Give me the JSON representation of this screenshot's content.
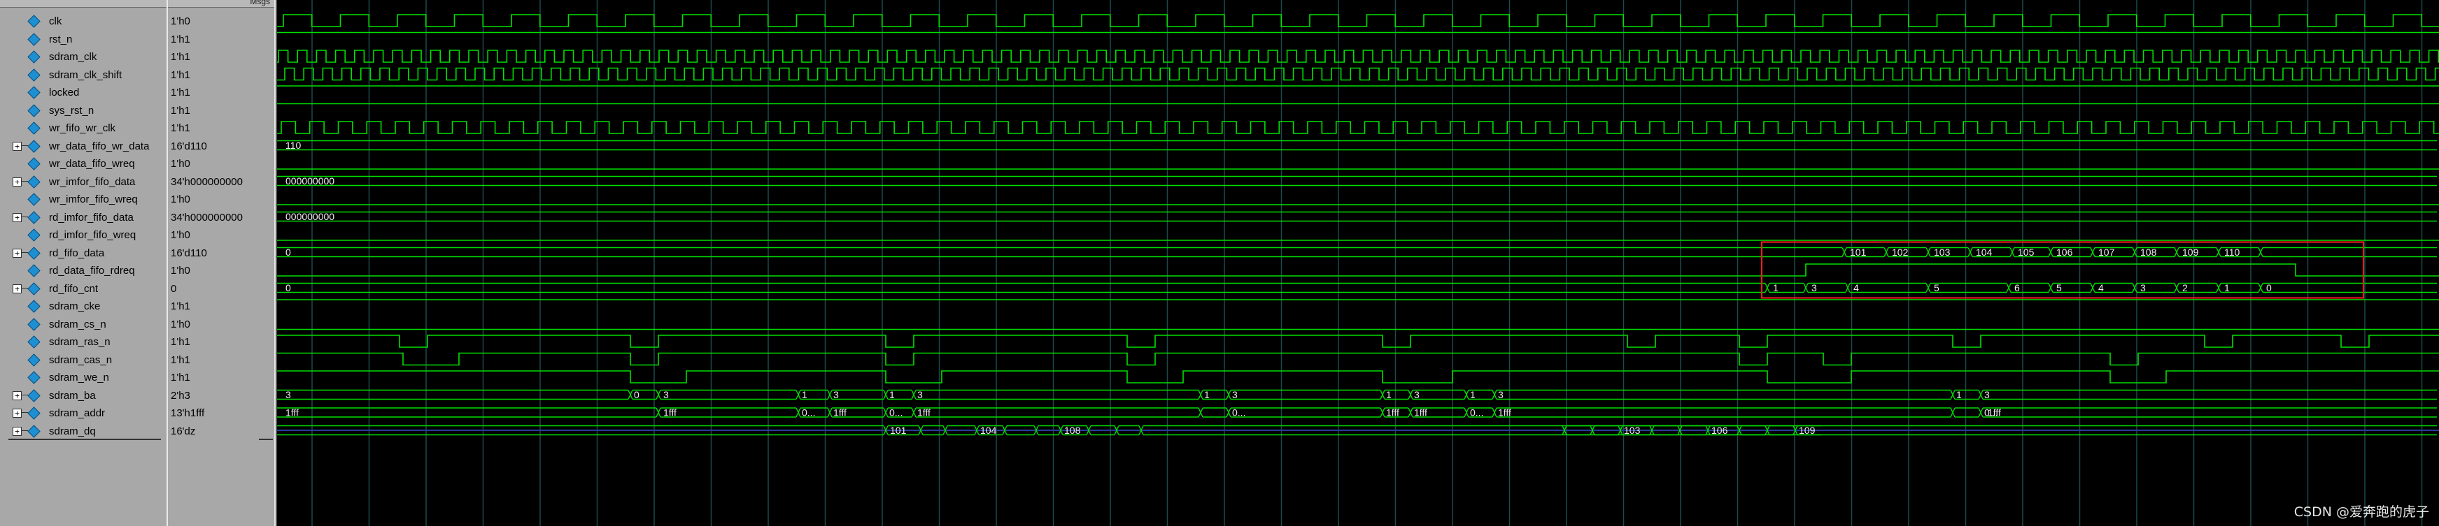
{
  "header": {
    "wave_label": "Msgs"
  },
  "signals": [
    {
      "name": "clk",
      "value": "1'h0",
      "expandable": false
    },
    {
      "name": "rst_n",
      "value": "1'h1",
      "expandable": false
    },
    {
      "name": "sdram_clk",
      "value": "1'h1",
      "expandable": false
    },
    {
      "name": "sdram_clk_shift",
      "value": "1'h1",
      "expandable": false
    },
    {
      "name": "locked",
      "value": "1'h1",
      "expandable": false
    },
    {
      "name": "sys_rst_n",
      "value": "1'h1",
      "expandable": false
    },
    {
      "name": "wr_fifo_wr_clk",
      "value": "1'h1",
      "expandable": false
    },
    {
      "name": "wr_data_fifo_wr_data",
      "value": "16'd110",
      "expandable": true
    },
    {
      "name": "wr_data_fifo_wreq",
      "value": "1'h0",
      "expandable": false
    },
    {
      "name": "wr_imfor_fifo_data",
      "value": "34'h000000000",
      "expandable": true
    },
    {
      "name": "wr_imfor_fifo_wreq",
      "value": "1'h0",
      "expandable": false
    },
    {
      "name": "rd_imfor_fifo_data",
      "value": "34'h000000000",
      "expandable": true
    },
    {
      "name": "rd_imfor_fifo_wreq",
      "value": "1'h0",
      "expandable": false
    },
    {
      "name": "rd_fifo_data",
      "value": "16'd110",
      "expandable": true
    },
    {
      "name": "rd_data_fifo_rdreq",
      "value": "1'h0",
      "expandable": false
    },
    {
      "name": "rd_fifo_cnt",
      "value": "0",
      "expandable": true
    },
    {
      "name": "sdram_cke",
      "value": "1'h1",
      "expandable": false
    },
    {
      "name": "sdram_cs_n",
      "value": "1'h0",
      "expandable": false
    },
    {
      "name": "sdram_ras_n",
      "value": "1'h1",
      "expandable": false
    },
    {
      "name": "sdram_cas_n",
      "value": "1'h1",
      "expandable": false
    },
    {
      "name": "sdram_we_n",
      "value": "1'h1",
      "expandable": false
    },
    {
      "name": "sdram_ba",
      "value": "2'h3",
      "expandable": true
    },
    {
      "name": "sdram_addr",
      "value": "13'h1fff",
      "expandable": true
    },
    {
      "name": "sdram_dq",
      "value": "16'dz",
      "expandable": true
    }
  ],
  "bus_labels": {
    "wr_data_fifo_wr_data": [
      "110"
    ],
    "wr_imfor_fifo_data": [
      "000000000"
    ],
    "rd_imfor_fifo_data": [
      "000000000"
    ],
    "rd_fifo_data": [
      "0",
      "101",
      "102",
      "103",
      "104",
      "105",
      "106",
      "107",
      "108",
      "109",
      "110"
    ],
    "rd_fifo_cnt": [
      "0",
      "1",
      "3",
      "4",
      "5",
      "6",
      "5",
      "4",
      "3",
      "2",
      "1",
      "0"
    ],
    "sdram_ba": [
      "3",
      "0",
      "3",
      "1",
      "3",
      "1",
      "3",
      "1",
      "3",
      "1",
      "3",
      "1",
      "3",
      "1",
      "3",
      "1",
      "3"
    ],
    "sdram_addr": [
      "1fff",
      "1fff",
      "0...",
      "1fff",
      "0...",
      "1fff",
      "0...",
      "1fff",
      "1fff",
      "0...",
      "1fff",
      "0...",
      "1fff",
      "1fff"
    ],
    "sdram_dq": [
      "101",
      "104",
      "108",
      "103",
      "106",
      "109"
    ]
  },
  "colors": {
    "wave": "#00e000",
    "highlight": "#ff2020",
    "grid": "#1c4a4a",
    "dq": "#2a3aa0"
  },
  "watermark": "CSDN @爱奔跑的虎子"
}
